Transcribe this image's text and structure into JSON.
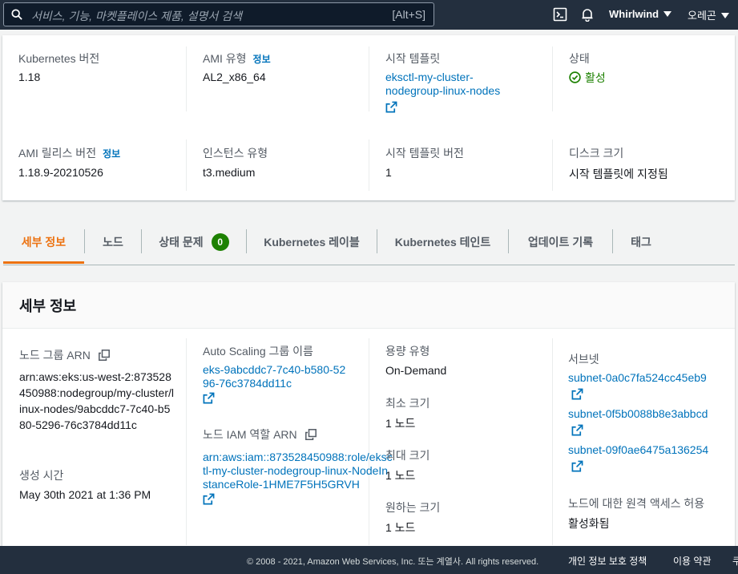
{
  "topnav": {
    "search_placeholder": "서비스, 기능, 마켓플레이스 제품, 설명서 검색",
    "search_shortcut": "[Alt+S]",
    "user": "Whirlwind",
    "region": "오레곤"
  },
  "config": {
    "k8s_version_label": "Kubernetes 버전",
    "k8s_version": "1.18",
    "ami_type_label": "AMI 유형",
    "ami_type": "AL2_x86_64",
    "launch_template_label": "시작 템플릿",
    "launch_template": "eksctl-my-cluster-nodegroup-linux-nodes",
    "status_label": "상태",
    "status": "활성",
    "ami_release_label": "AMI 릴리스 버전",
    "ami_release": "1.18.9-20210526",
    "instance_type_label": "인스턴스 유형",
    "instance_type": "t3.medium",
    "launch_template_version_label": "시작 템플릿 버전",
    "launch_template_version": "1",
    "disk_size_label": "디스크 크기",
    "disk_size": "시작 템플릿에 지정됨",
    "info_label": "정보"
  },
  "tabs": [
    {
      "label": "세부 정보"
    },
    {
      "label": "노드"
    },
    {
      "label": "상태 문제",
      "badge": "0"
    },
    {
      "label": "Kubernetes 레이블"
    },
    {
      "label": "Kubernetes 테인트"
    },
    {
      "label": "업데이트 기록"
    },
    {
      "label": "태그"
    }
  ],
  "details": {
    "title": "세부 정보",
    "nodegroup_arn_label": "노드 그룹 ARN",
    "nodegroup_arn": "arn:aws:eks:us-west-2:873528450988:nodegroup/my-cluster/linux-nodes/9abcddc7-7c40-b580-5296-76c3784dd11c",
    "created_label": "생성 시간",
    "created": "May 30th 2021 at 1:36 PM",
    "asg_label": "Auto Scaling 그룹 이름",
    "asg": "eks-9abcddc7-7c40-b580-5296-76c3784dd11c",
    "iam_role_label": "노드 IAM 역할 ARN",
    "iam_role": "arn:aws:iam::873528450988:role/eksctl-my-cluster-nodegroup-linux-NodeInstanceRole-1HME7F5H5GRVH",
    "capacity_label": "용량 유형",
    "capacity": "On-Demand",
    "min_label": "최소 크기",
    "min": "1 노드",
    "max_label": "최대 크기",
    "max": "1 노드",
    "desired_label": "원하는 크기",
    "desired": "1 노드",
    "subnets_label": "서브넷",
    "subnets": [
      "subnet-0a0c7fa524cc45eb9",
      "subnet-0f5b0088b8e3abbcd",
      "subnet-09f0ae6475a136254"
    ],
    "remote_access_label": "노드에 대한 원격 액세스 허용",
    "remote_access": "활성화됨"
  },
  "footer": {
    "copyright": "© 2008 - 2021, Amazon Web Services, Inc. 또는 계열사. All rights reserved.",
    "privacy": "개인 정보 보호 정책",
    "terms": "이용 약관",
    "more": "쿠"
  },
  "colors": {
    "nav_bg": "#232f3e",
    "link": "#0073bb",
    "active_tab": "#ec7211",
    "success": "#1d8102"
  }
}
